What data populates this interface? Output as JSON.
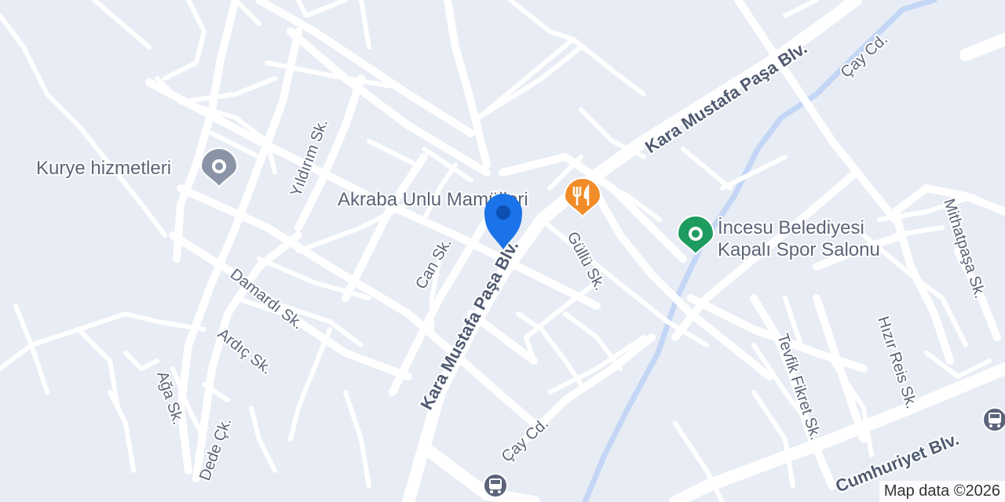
{
  "map": {
    "attribution": "Map data ©2026",
    "colors": {
      "background": "#e8ecf4",
      "road": "#ffffff",
      "river": "#c3d6f5",
      "label": "#5b6478",
      "pin_blue": "#1a73e8",
      "poi_gray": "#8a94a6",
      "poi_orange": "#f28c28",
      "poi_green": "#1e9b5f"
    },
    "streets": {
      "kara_mustafa_pasa_upper": "Kara Mustafa Paşa Blv.",
      "kara_mustafa_pasa_lower": "Kara Mustafa Paşa Blv.",
      "cay_cd_upper": "Çay Cd.",
      "cay_cd_lower": "Çay Cd.",
      "yildirim": "Yıldırım Sk.",
      "can": "Can Sk.",
      "gullu": "Güllü Sk.",
      "damardi": "Damardı Sk.",
      "ardic": "Ardıç Sk.",
      "aga": "Ağa Sk.",
      "dede": "Dede Çk.",
      "tevfik_fikret": "Tevfik Fikret Sk.",
      "hizir_reis": "Hızır Reis Sk.",
      "mithatpasa": "Mithatpaşa Sk.",
      "cumhuriyet": "Cumhuriyet Blv."
    },
    "pois": {
      "kurye": {
        "name": "Kurye hizmetleri",
        "icon": "courier-pin-icon"
      },
      "akraba": {
        "name": "Akraba Unlu Mamülleri",
        "icon": "restaurant-pin-icon"
      },
      "spor_line1": "İncesu Belediyesi",
      "spor_line2": "Kapalı Spor Salonu",
      "spor_icon": "park-pin-icon"
    },
    "markers": {
      "location": "location-pin-icon",
      "bus": "bus-stop-icon"
    }
  }
}
